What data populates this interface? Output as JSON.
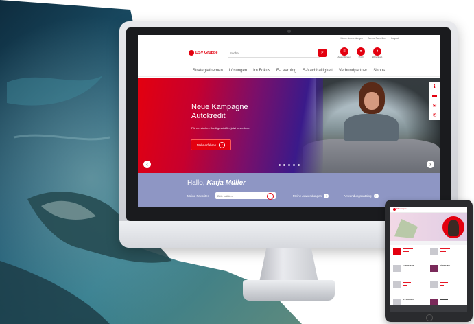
{
  "utility_bar": {
    "items": [
      "Meine Anwendungen",
      "Meine Favoriten",
      "Logout"
    ]
  },
  "header": {
    "logo": "DSV Gruppe",
    "search_placeholder": "Suche",
    "icons": [
      {
        "icon": "list-icon",
        "label": "Anwendungen"
      },
      {
        "icon": "user-icon",
        "label": "Profil"
      },
      {
        "icon": "cart-icon",
        "label": "Warenkorb"
      }
    ]
  },
  "nav": {
    "items": [
      "Strategiethemen",
      "Lösungen",
      "Im Fokus",
      "E-Learning",
      "S-Nachhaltigkeit",
      "Verbundpartner",
      "Shops"
    ]
  },
  "hero": {
    "title_line1": "Neue Kampagne",
    "title_line2": "Autokredit",
    "subtitle": "Für ein starkes Kreditgeschäft – jetzt bewerben.",
    "cta_label": "Mehr erfahren",
    "slide_count": 5
  },
  "side_rail": {
    "icons": [
      "info-icon",
      "chat-icon",
      "mail-icon",
      "phone-icon"
    ]
  },
  "greeting": {
    "hello": "Hallo,",
    "name": "Katja Müller",
    "favorites_label": "Meine Favoriten",
    "favorites_placeholder": "Bitte wählen",
    "links": [
      "Meine Anwendungen",
      "Anwendungskatalog"
    ]
  },
  "colors": {
    "brand_red": "#e3000f",
    "greeting_bg": "#8e96c4"
  },
  "tablet": {
    "logo": "DSV Gruppe",
    "badge_a": "5 VERLAUF",
    "badge_b": "S-FRAGEN",
    "badge_c": "KÜRBUNG"
  }
}
